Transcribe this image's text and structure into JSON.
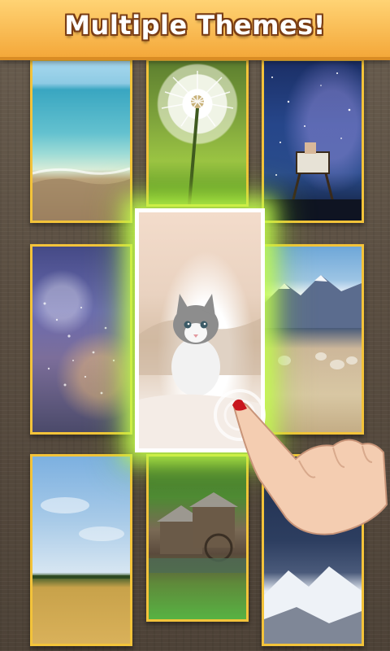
{
  "header": {
    "title": "Multiple Themes!"
  },
  "themes": [
    {
      "name": "beach",
      "selected": false
    },
    {
      "name": "dandelion",
      "selected": false
    },
    {
      "name": "starry-night-lifeguard-tower",
      "selected": false
    },
    {
      "name": "rainy-window",
      "selected": false
    },
    {
      "name": "kitten",
      "selected": true
    },
    {
      "name": "mountain-sheep",
      "selected": false
    },
    {
      "name": "wheat-field-sky",
      "selected": false
    },
    {
      "name": "water-mill",
      "selected": false
    },
    {
      "name": "snowy-mountain-night",
      "selected": false
    }
  ],
  "colors": {
    "banner": "#f4a83a",
    "banner_highlight": "#ffd374",
    "title_outline": "#7a3d14",
    "tile_border": "#f3c33a",
    "selected_glow": "#c8ff50",
    "background": "#5b4f42"
  },
  "icons": {
    "hand": "pointing-hand-icon",
    "tap": "tap-ripple-icon"
  }
}
